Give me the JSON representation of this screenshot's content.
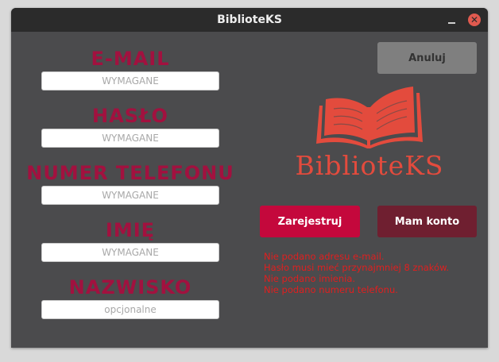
{
  "window": {
    "title": "BiblioteKS",
    "close_glyph": "✕"
  },
  "form": {
    "fields": [
      {
        "label": "E-MAIL",
        "placeholder": "WYMAGANE"
      },
      {
        "label": "HASŁO",
        "placeholder": "WYMAGANE"
      },
      {
        "label": "NUMER TELEFONU",
        "placeholder": "WYMAGANE"
      },
      {
        "label": "IMIĘ",
        "placeholder": "WYMAGANE"
      },
      {
        "label": "NAZWISKO",
        "placeholder": "opcjonalne"
      }
    ]
  },
  "buttons": {
    "cancel": "Anuluj",
    "register": "Zarejestruj",
    "have_account": "Mam konto"
  },
  "logo": {
    "text": "BiblioteKS",
    "icon": "open-book-icon"
  },
  "errors": [
    "Nie podano adresu e-mail.",
    "Hasło musi mieć przynajmniej 8 znaków.",
    "Nie podano imienia.",
    "Nie podano numeru telefonu."
  ],
  "colors": {
    "label": "#a2113f",
    "register_button": "#c4083c",
    "account_button": "#6f1f30",
    "cancel_button": "#7f7f7f",
    "logo": "#e34b3d",
    "error": "#e01f1f",
    "background": "#4b4b4d",
    "titlebar": "#2b2b2b"
  }
}
